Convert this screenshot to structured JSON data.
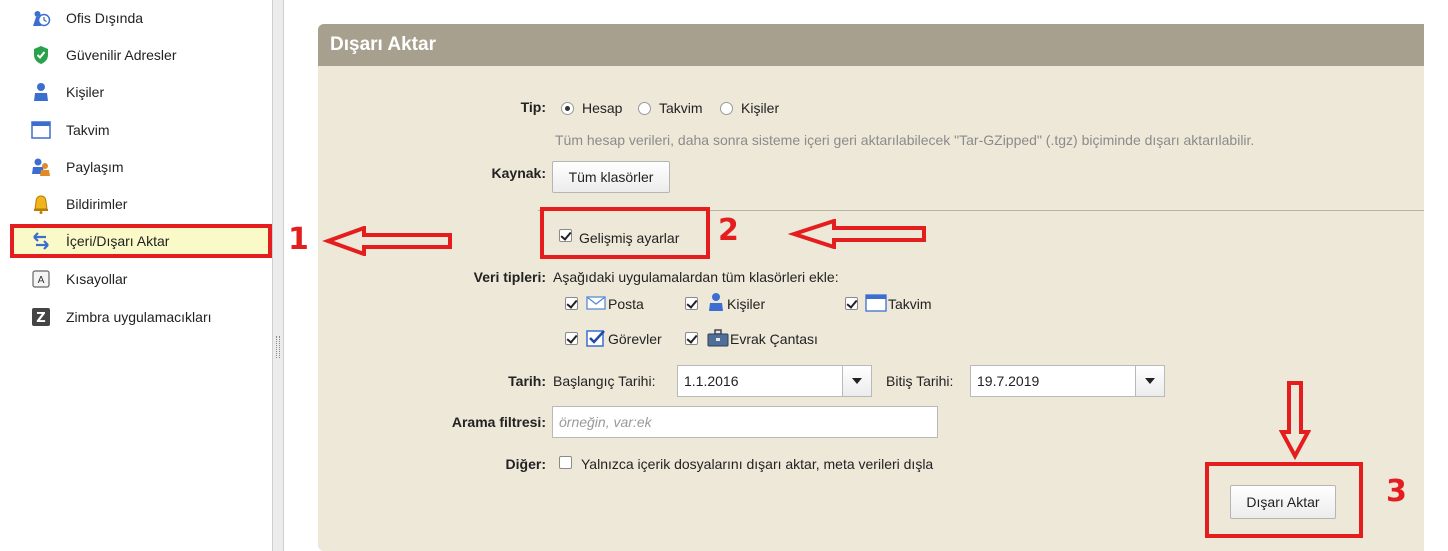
{
  "sidebar": {
    "items": [
      {
        "label": "Ofis Dışında",
        "icon": "out-of-office-icon"
      },
      {
        "label": "Güvenilir Adresler",
        "icon": "shield-icon"
      },
      {
        "label": "Kişiler",
        "icon": "contacts-icon"
      },
      {
        "label": "Takvim",
        "icon": "calendar-icon"
      },
      {
        "label": "Paylaşım",
        "icon": "sharing-icon"
      },
      {
        "label": "Bildirimler",
        "icon": "bell-icon"
      },
      {
        "label": "İçeri/Dışarı Aktar",
        "icon": "import-export-icon",
        "selected": true
      },
      {
        "label": "Kısayollar",
        "icon": "keyboard-shortcut-icon"
      },
      {
        "label": "Zimbra uygulamacıkları",
        "icon": "zimbra-icon"
      }
    ]
  },
  "panel": {
    "title": "Dışarı Aktar",
    "type": {
      "label": "Tip:",
      "options": [
        "Hesap",
        "Takvim",
        "Kişiler"
      ],
      "selected": "Hesap",
      "description": "Tüm hesap verileri, daha sonra sisteme içeri geri aktarılabilecek \"Tar-GZipped\" (.tgz) biçiminde dışarı aktarılabilir."
    },
    "source": {
      "label": "Kaynak:",
      "button": "Tüm klasörler"
    },
    "advanced": {
      "label": "Gelişmiş ayarlar",
      "checked": true
    },
    "data_types": {
      "label": "Veri tipleri:",
      "description": "Aşağıdaki uygulamalardan tüm klasörleri ekle:",
      "items": [
        {
          "label": "Posta",
          "icon": "mail-icon",
          "checked": true
        },
        {
          "label": "Kişiler",
          "icon": "contacts-icon",
          "checked": true
        },
        {
          "label": "Takvim",
          "icon": "calendar-icon",
          "checked": true
        },
        {
          "label": "Görevler",
          "icon": "tasks-icon",
          "checked": true
        },
        {
          "label": "Evrak Çantası",
          "icon": "briefcase-icon",
          "checked": true
        }
      ]
    },
    "date": {
      "label": "Tarih:",
      "start_label": "Başlangıç Tarihi:",
      "start_value": "1.1.2016",
      "end_label": "Bitiş Tarihi:",
      "end_value": "19.7.2019"
    },
    "search": {
      "label": "Arama filtresi:",
      "value": "",
      "placeholder": "örneğin, var:ek"
    },
    "other": {
      "label": "Diğer:",
      "option": "Yalnızca içerik dosyalarını dışarı aktar, meta verileri dışla",
      "checked": false
    },
    "export_button": "Dışarı Aktar"
  },
  "annotations": {
    "step1": "1",
    "step2": "2",
    "step3": "3",
    "color": "#e41e1e"
  },
  "colors": {
    "panel_header": "#a7a08f",
    "panel_body": "#eee8d9",
    "selected_item": "#fafac8"
  }
}
